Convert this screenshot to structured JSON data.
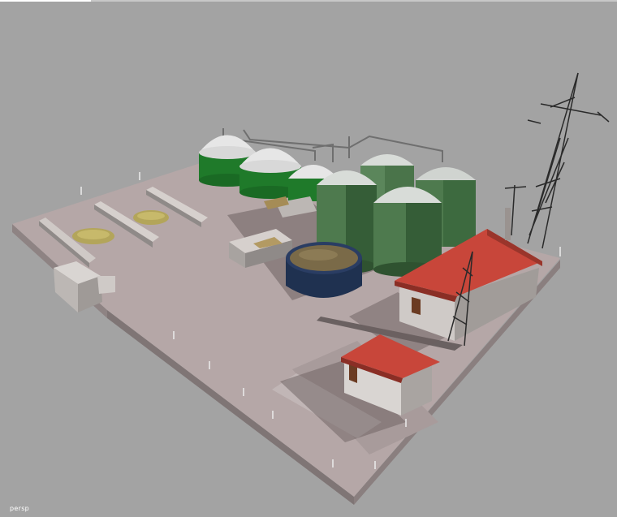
{
  "viewport": {
    "label": "persp",
    "background": "#a3a3a3"
  },
  "colors": {
    "ground_top": "#b5a7a7",
    "ground_side": "#8e8383",
    "tank_green_light": "#4e7a4e",
    "tank_green_dark": "#2f5230",
    "digester_green": "#1f7a2a",
    "dome_white": "#e6e6e6",
    "roof_red": "#c8463a",
    "wall_white": "#d9d5d2",
    "pool_rim": "#1f3150",
    "pool_fill": "#7a6a48",
    "pylon": "#2a2a2a",
    "silage": "#b3a55a"
  }
}
